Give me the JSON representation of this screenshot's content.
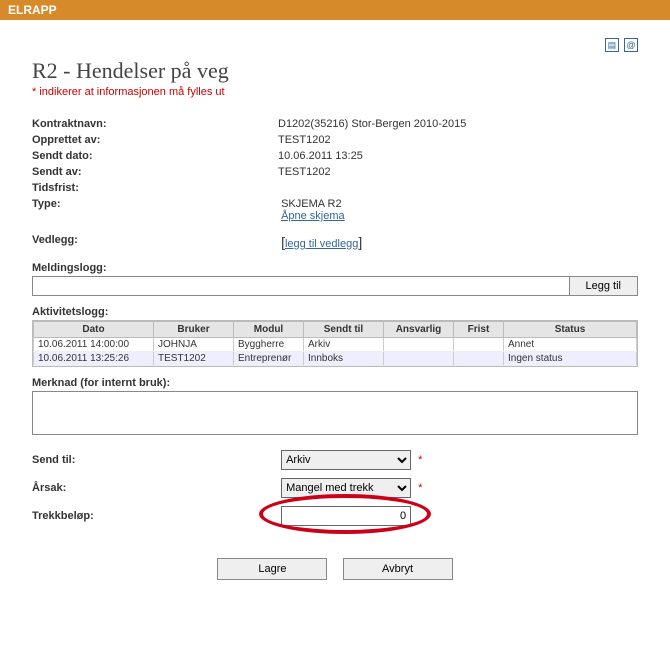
{
  "app": {
    "name": "ELRAPP"
  },
  "page": {
    "title": "R2 - Hendelser på veg",
    "required_note": "* indikerer at informasjonen må fylles ut"
  },
  "info": {
    "kontraktnavn_label": "Kontraktnavn:",
    "kontraktnavn_value": "D1202(35216) Stor-Bergen 2010-2015",
    "opprettet_av_label": "Opprettet av:",
    "opprettet_av_value": "TEST1202",
    "sendt_dato_label": "Sendt dato:",
    "sendt_dato_value": "10.06.2011 13:25",
    "sendt_av_label": "Sendt av:",
    "sendt_av_value": "TEST1202",
    "tidsfrist_label": "Tidsfrist:",
    "tidsfrist_value": "",
    "type_label": "Type:",
    "type_value": "SKJEMA R2",
    "type_link": "Åpne skjema",
    "vedlegg_label": "Vedlegg:",
    "vedlegg_link": "legg til vedlegg"
  },
  "meldingslogg": {
    "label": "Meldingslogg:",
    "add_button": "Legg til"
  },
  "aktivitetslogg": {
    "label": "Aktivitetslogg:",
    "headers": {
      "dato": "Dato",
      "bruker": "Bruker",
      "modul": "Modul",
      "sendt_til": "Sendt til",
      "ansvarlig": "Ansvarlig",
      "frist": "Frist",
      "status": "Status"
    },
    "rows": [
      {
        "dato": "10.06.2011 14:00:00",
        "bruker": "JOHNJA",
        "modul": "Byggherre",
        "sendt_til": "Arkiv",
        "ansvarlig": "",
        "frist": "",
        "status": "Annet"
      },
      {
        "dato": "10.06.2011 13:25:26",
        "bruker": "TEST1202",
        "modul": "Entreprenør",
        "sendt_til": "Innboks",
        "ansvarlig": "",
        "frist": "",
        "status": "Ingen status"
      }
    ]
  },
  "merknad": {
    "label": "Merknad (for internt bruk):",
    "value": ""
  },
  "form": {
    "send_til_label": "Send til:",
    "send_til_value": "Arkiv",
    "arsak_label": "Årsak:",
    "arsak_value": "Mangel med trekk",
    "trekk_label": "Trekkbeløp:",
    "trekk_value": "0"
  },
  "buttons": {
    "lagre": "Lagre",
    "avbryt": "Avbryt"
  }
}
